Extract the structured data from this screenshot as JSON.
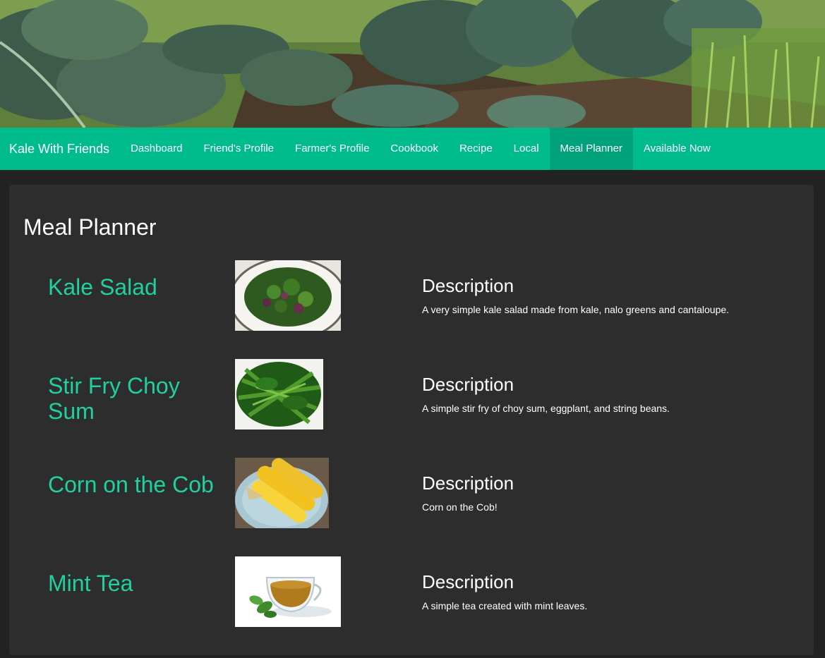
{
  "navbar": {
    "brand": "Kale With Friends",
    "items": [
      {
        "label": "Dashboard"
      },
      {
        "label": "Friend's Profile"
      },
      {
        "label": "Farmer's Profile"
      },
      {
        "label": "Cookbook"
      },
      {
        "label": "Recipe"
      },
      {
        "label": "Local"
      },
      {
        "label": "Meal Planner",
        "active": true
      },
      {
        "label": "Available Now"
      }
    ]
  },
  "page": {
    "title": "Meal Planner"
  },
  "meals": [
    {
      "name": "Kale Salad",
      "image": "kale-salad-photo",
      "description_heading": "Description",
      "description": "A very simple kale salad made from kale, nalo greens and cantaloupe."
    },
    {
      "name": "Stir Fry Choy Sum",
      "image": "choy-sum-photo",
      "description_heading": "Description",
      "description": "A simple stir fry of choy sum, eggplant, and string beans."
    },
    {
      "name": "Corn on the Cob",
      "image": "corn-photo",
      "description_heading": "Description",
      "description": "Corn on the Cob!"
    },
    {
      "name": "Mint Tea",
      "image": "mint-tea-photo",
      "description_heading": "Description",
      "description": "A simple tea created with mint leaves."
    }
  ],
  "colors": {
    "navbar": "#00bc8c",
    "navbar_active": "#00a379",
    "accent_text": "#1fd19f",
    "panel": "#2d2d2d",
    "background": "#222222"
  }
}
